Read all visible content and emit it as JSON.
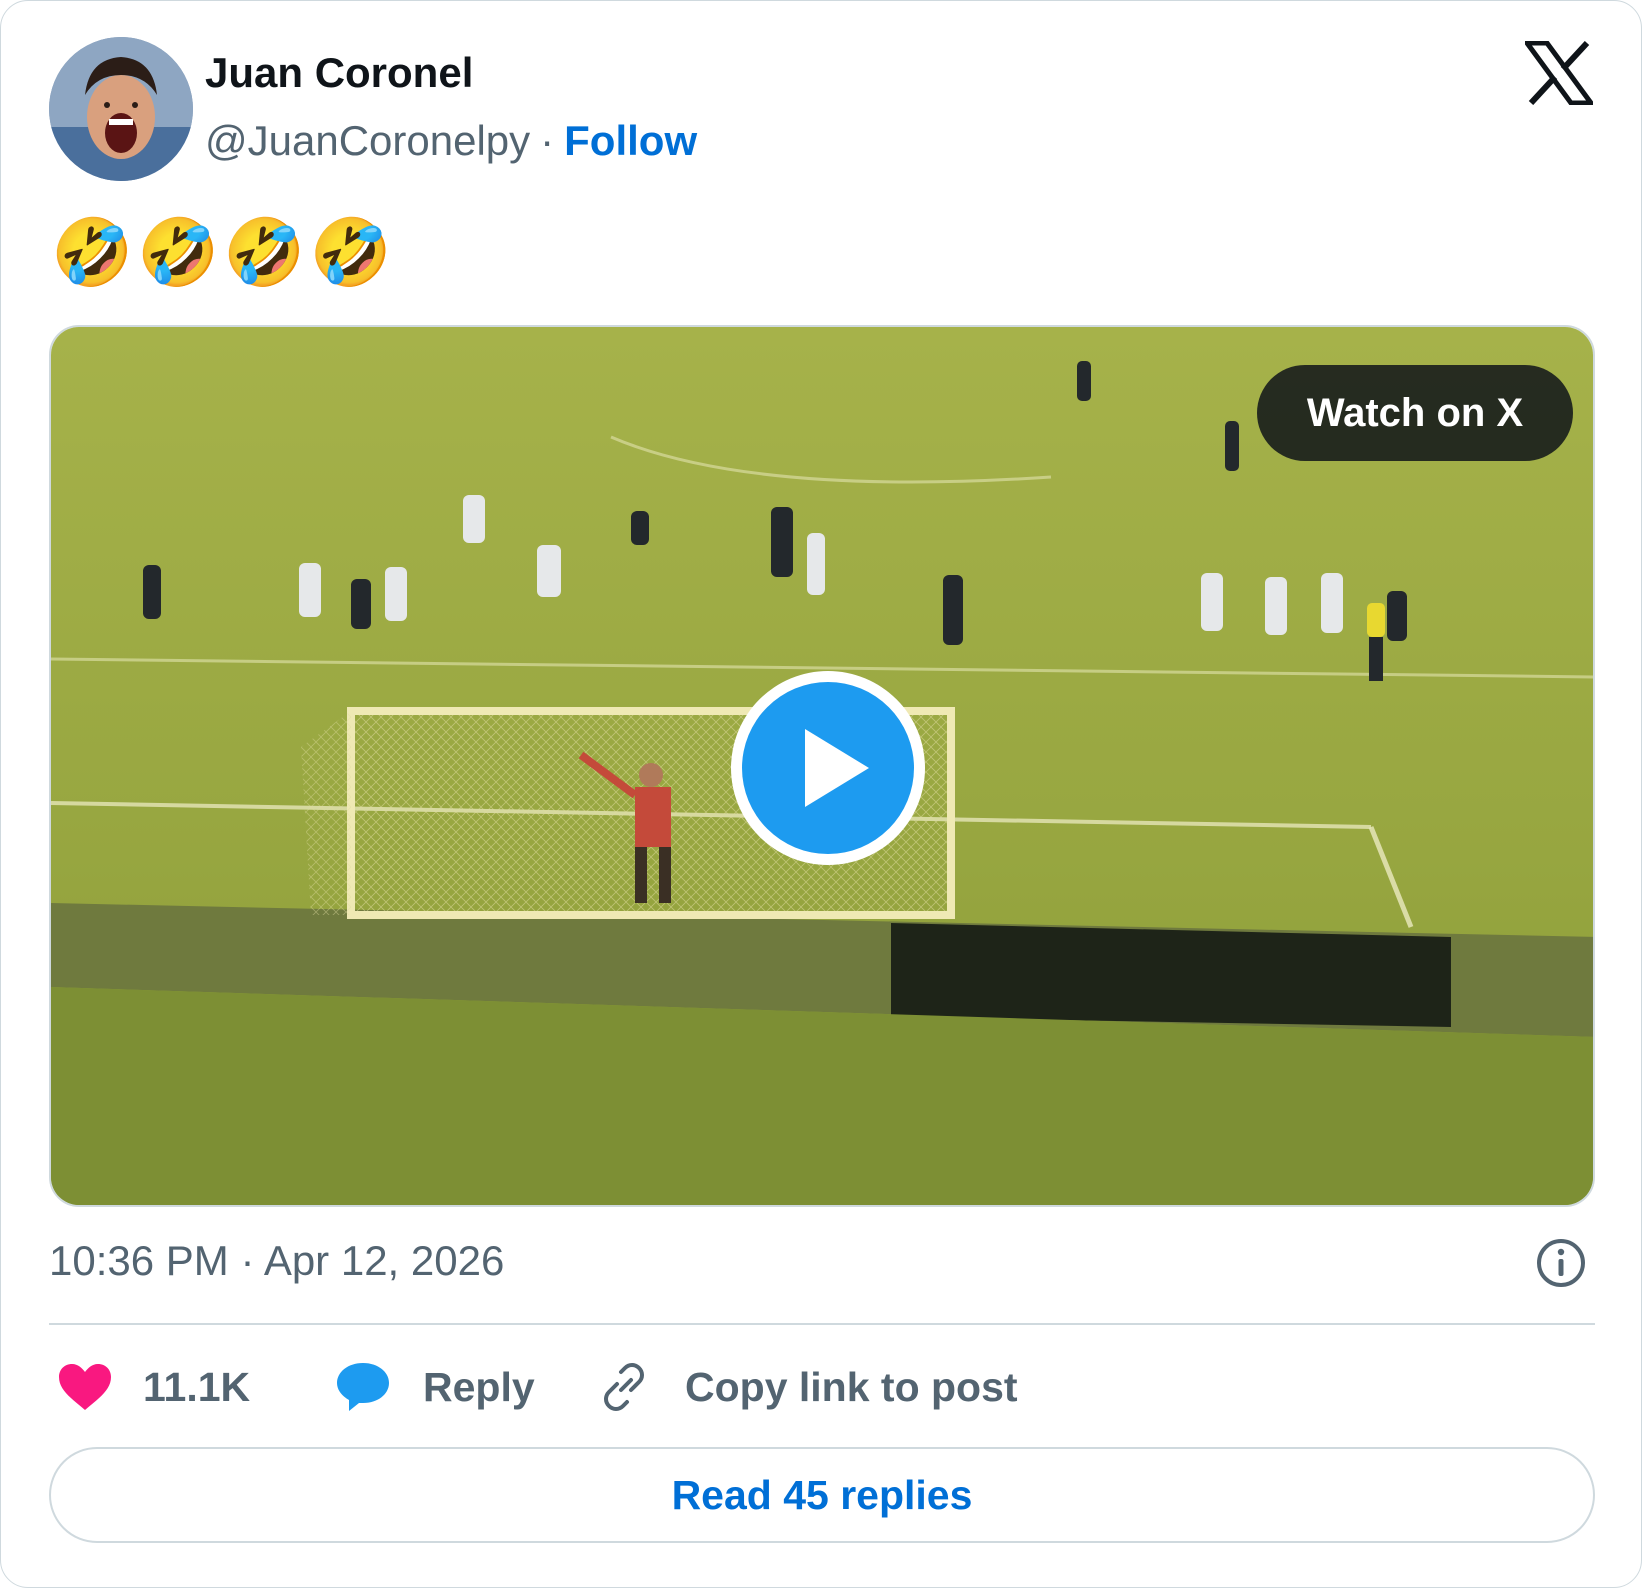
{
  "author": {
    "name": "Juan Coronel",
    "handle": "@JuanCoronelpy",
    "separator": "·",
    "follow_label": "Follow"
  },
  "post": {
    "text": "🤣🤣🤣🤣"
  },
  "media": {
    "watch_label": "Watch on X",
    "play_icon": "play-icon"
  },
  "meta": {
    "time": "10:36 PM",
    "separator": "·",
    "date": "Apr 12, 2026",
    "info_icon": "info-icon"
  },
  "actions": {
    "likes": "11.1K",
    "reply_label": "Reply",
    "copy_label": "Copy link to post",
    "read_replies_label": "Read 45 replies"
  },
  "colors": {
    "link": "#006fd6",
    "like": "#f91880",
    "reply": "#1d9bf0",
    "muted": "#536471",
    "play": "#1d9bf0"
  }
}
